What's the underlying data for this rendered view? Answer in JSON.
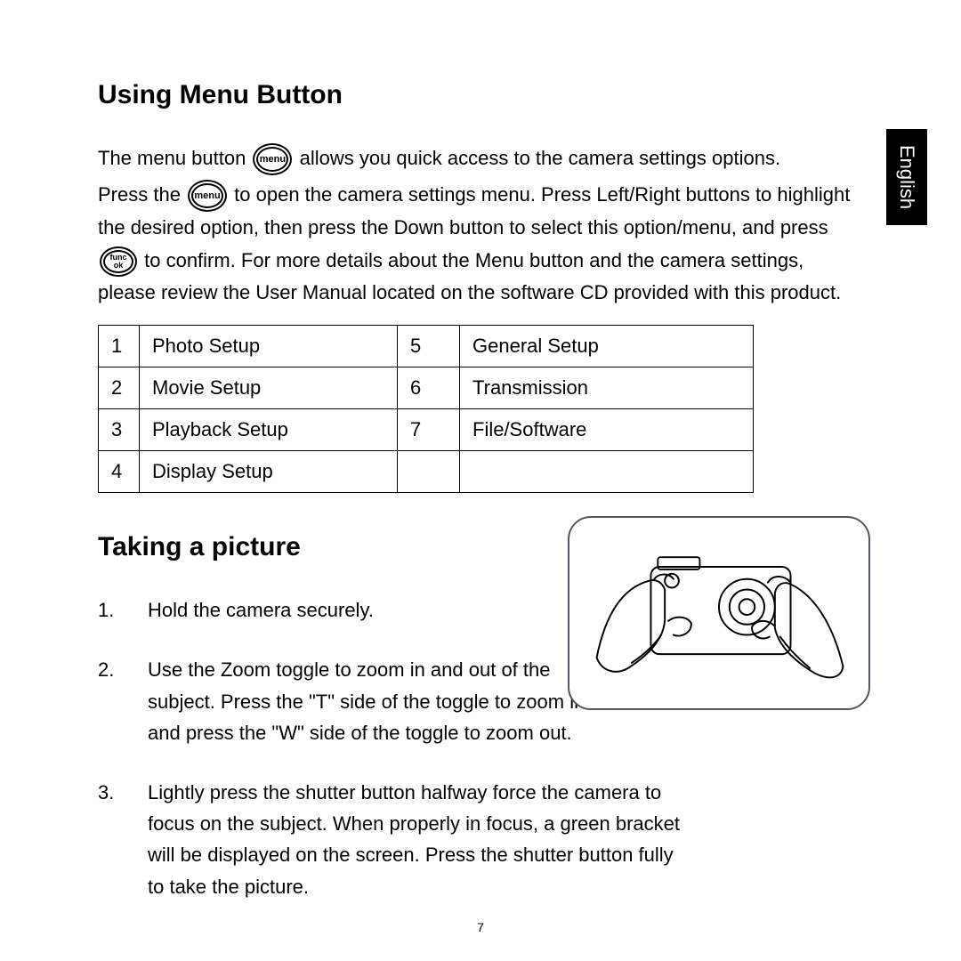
{
  "langTab": "English",
  "section1": {
    "heading": "Using Menu Button",
    "para1_a": "The menu button ",
    "para1_b": " allows you quick access to the camera settings options.",
    "para2_a": "Press the ",
    "para2_b": " to open the camera settings menu. Press Left/Right buttons to highlight the desired option, then press the Down button to select this option/menu, and press ",
    "para2_c": " to confirm. For more details about the Menu button and the camera settings, please review the User Manual located on the software CD provided with this product.",
    "btn_menu": "menu",
    "btn_func_top": "func",
    "btn_func_bot": "ok"
  },
  "table": {
    "rows": [
      {
        "n1": "1",
        "l1": "Photo Setup",
        "n2": "5",
        "l2": "General Setup"
      },
      {
        "n1": "2",
        "l1": "Movie Setup",
        "n2": "6",
        "l2": "Transmission"
      },
      {
        "n1": "3",
        "l1": "Playback Setup",
        "n2": "7",
        "l2": "File/Software"
      },
      {
        "n1": "4",
        "l1": "Display Setup",
        "n2": "",
        "l2": ""
      }
    ]
  },
  "section2": {
    "heading": "Taking a picture",
    "steps": [
      {
        "n": "1.",
        "t": "Hold the camera securely."
      },
      {
        "n": "2.",
        "t": "Use the Zoom toggle to zoom in and out of the subject. Press the \"T\" side of the toggle to zoom in and press the \"W\" side of the toggle to zoom out."
      },
      {
        "n": "3.",
        "t": "Lightly press the shutter button halfway force the camera to focus on the subject. When properly in focus, a green bracket will be displayed on the screen.  Press the shutter button fully to take the picture."
      }
    ]
  },
  "pageNumber": "7"
}
